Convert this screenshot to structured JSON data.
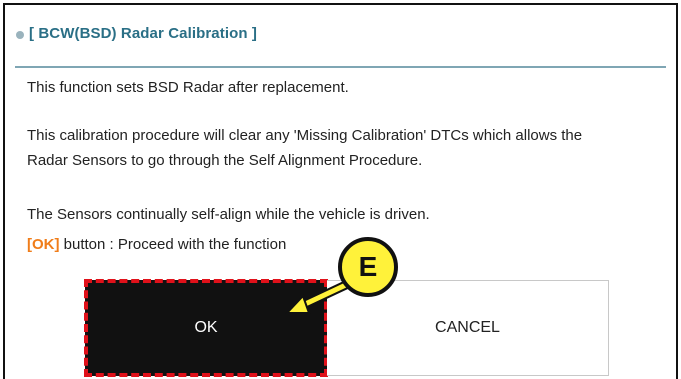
{
  "dialog": {
    "title": "[ BCW(BSD) Radar Calibration ]",
    "line1": "This function sets BSD Radar after replacement.",
    "line2": "This calibration procedure will clear any 'Missing Calibration' DTCs which allows the",
    "line3": "Radar Sensors to go through the Self Alignment Procedure.",
    "line4": "The Sensors continually self-align while the vehicle is driven.",
    "ok_tag": "[OK]",
    "line5_rest": " button : Proceed with the function"
  },
  "buttons": {
    "ok_label": "OK",
    "cancel_label": "CANCEL"
  },
  "callout": {
    "letter": "E"
  },
  "colors": {
    "title": "#2a6f86",
    "ok_tag": "#f07d1a",
    "highlight_dash": "#e0111a",
    "callout_fill": "#fff23a"
  }
}
